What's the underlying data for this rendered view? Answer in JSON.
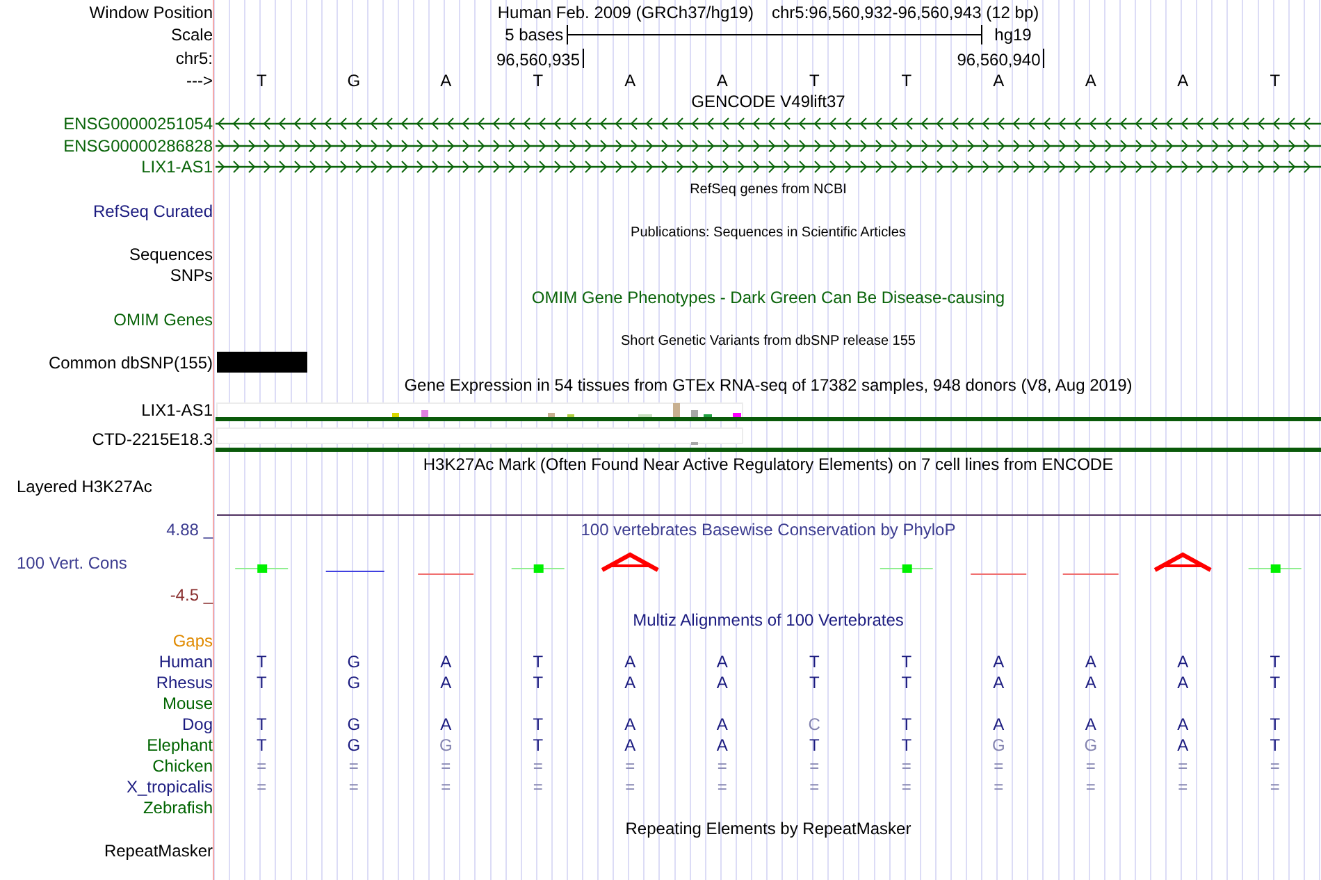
{
  "header": {
    "label": "Window Position",
    "assembly": "Human Feb. 2009 (GRCh37/hg19)",
    "position": "chr5:96,560,932-96,560,943 (12 bp)"
  },
  "scale": {
    "label": "Scale",
    "length": "5 bases",
    "db": "hg19"
  },
  "coordinates": {
    "label": "chr5:",
    "ticks": [
      "96,560,935",
      "96,560,940"
    ]
  },
  "sequence": {
    "label": "--->",
    "bases": [
      "T",
      "G",
      "A",
      "T",
      "A",
      "A",
      "T",
      "T",
      "A",
      "A",
      "A",
      "T"
    ]
  },
  "gencode": {
    "title": "GENCODE V49lift37",
    "genes": [
      {
        "name": "ENSG00000251054",
        "reverse_strand": true
      },
      {
        "name": "ENSG00000286828",
        "reverse_strand": false
      },
      {
        "name": "LIX1-AS1",
        "reverse_strand": false
      }
    ]
  },
  "refseq": {
    "title": "RefSeq genes from NCBI",
    "label": "RefSeq Curated"
  },
  "publications": {
    "title": "Publications: Sequences in Scientific Articles",
    "labels": [
      "Sequences",
      "SNPs"
    ]
  },
  "omim": {
    "title": "OMIM Gene Phenotypes - Dark Green Can Be Disease-causing",
    "label": "OMIM Genes"
  },
  "dbsnp": {
    "title": "Short Genetic Variants from dbSNP release 155",
    "label": "Common dbSNP(155)"
  },
  "gtex": {
    "title": "Gene Expression in 54 tissues from GTEx RNA-seq of 17382 samples, 948 donors (V8, Aug 2019)",
    "genes": [
      "LIX1-AS1",
      "CTD-2215E18.3"
    ]
  },
  "h3k27ac": {
    "title": "H3K27Ac Mark (Often Found Near Active Regulatory Elements) on 7 cell lines from ENCODE",
    "label": "Layered H3K27Ac"
  },
  "conservation": {
    "title": "100 vertebrates Basewise Conservation by PhyloP",
    "label": "100 Vert. Cons",
    "max": "4.88 _",
    "min": "-4.5 _"
  },
  "multiz": {
    "title": "Multiz Alignments of 100 Vertebrates",
    "gaps_label": "Gaps",
    "species": [
      {
        "name": "Human",
        "color": "#1c1c80",
        "bases": [
          {
            "b": "T",
            "match": true
          },
          {
            "b": "G",
            "match": true
          },
          {
            "b": "A",
            "match": true
          },
          {
            "b": "T",
            "match": true
          },
          {
            "b": "A",
            "match": true
          },
          {
            "b": "A",
            "match": true
          },
          {
            "b": "T",
            "match": true
          },
          {
            "b": "T",
            "match": true
          },
          {
            "b": "A",
            "match": true
          },
          {
            "b": "A",
            "match": true
          },
          {
            "b": "A",
            "match": true
          },
          {
            "b": "T",
            "match": true
          }
        ]
      },
      {
        "name": "Rhesus",
        "color": "#1c1c80",
        "bases": [
          {
            "b": "T",
            "match": true
          },
          {
            "b": "G",
            "match": true
          },
          {
            "b": "A",
            "match": true
          },
          {
            "b": "T",
            "match": true
          },
          {
            "b": "A",
            "match": true
          },
          {
            "b": "A",
            "match": true
          },
          {
            "b": "T",
            "match": true
          },
          {
            "b": "T",
            "match": true
          },
          {
            "b": "A",
            "match": true
          },
          {
            "b": "A",
            "match": true
          },
          {
            "b": "A",
            "match": true
          },
          {
            "b": "T",
            "match": true
          }
        ]
      },
      {
        "name": "Mouse",
        "color": "#006400"
      },
      {
        "name": "Dog",
        "color": "#1c1c80",
        "bases": [
          {
            "b": "T",
            "match": true
          },
          {
            "b": "G",
            "match": true
          },
          {
            "b": "A",
            "match": true
          },
          {
            "b": "T",
            "match": true
          },
          {
            "b": "A",
            "match": true
          },
          {
            "b": "A",
            "match": true
          },
          {
            "b": "C",
            "match": false
          },
          {
            "b": "T",
            "match": true
          },
          {
            "b": "A",
            "match": true
          },
          {
            "b": "A",
            "match": true
          },
          {
            "b": "A",
            "match": true
          },
          {
            "b": "T",
            "match": true
          }
        ]
      },
      {
        "name": "Elephant",
        "color": "#006400",
        "bases": [
          {
            "b": "T",
            "match": true
          },
          {
            "b": "G",
            "match": true
          },
          {
            "b": "G",
            "match": false
          },
          {
            "b": "T",
            "match": true
          },
          {
            "b": "A",
            "match": true
          },
          {
            "b": "A",
            "match": true
          },
          {
            "b": "T",
            "match": true
          },
          {
            "b": "T",
            "match": true
          },
          {
            "b": "G",
            "match": false
          },
          {
            "b": "G",
            "match": false
          },
          {
            "b": "A",
            "match": true
          },
          {
            "b": "T",
            "match": true
          }
        ]
      },
      {
        "name": "Chicken",
        "color": "#006400",
        "bases": [
          {
            "b": "=",
            "match": false
          },
          {
            "b": "=",
            "match": false
          },
          {
            "b": "=",
            "match": false
          },
          {
            "b": "=",
            "match": false
          },
          {
            "b": "=",
            "match": false
          },
          {
            "b": "=",
            "match": false
          },
          {
            "b": "=",
            "match": false
          },
          {
            "b": "=",
            "match": false
          },
          {
            "b": "=",
            "match": false
          },
          {
            "b": "=",
            "match": false
          },
          {
            "b": "=",
            "match": false
          },
          {
            "b": "=",
            "match": false
          }
        ]
      },
      {
        "name": "X_tropicalis",
        "color": "#1c1c80",
        "bases": [
          {
            "b": "=",
            "match": false
          },
          {
            "b": "=",
            "match": false
          },
          {
            "b": "=",
            "match": false
          },
          {
            "b": "=",
            "match": false
          },
          {
            "b": "=",
            "match": false
          },
          {
            "b": "=",
            "match": false
          },
          {
            "b": "=",
            "match": false
          },
          {
            "b": "=",
            "match": false
          },
          {
            "b": "=",
            "match": false
          },
          {
            "b": "=",
            "match": false
          },
          {
            "b": "=",
            "match": false
          },
          {
            "b": "=",
            "match": false
          }
        ]
      },
      {
        "name": "Zebrafish",
        "color": "#006400"
      }
    ]
  },
  "repeatmasker": {
    "title": "Repeating Elements by RepeatMasker",
    "label": "RepeatMasker"
  }
}
